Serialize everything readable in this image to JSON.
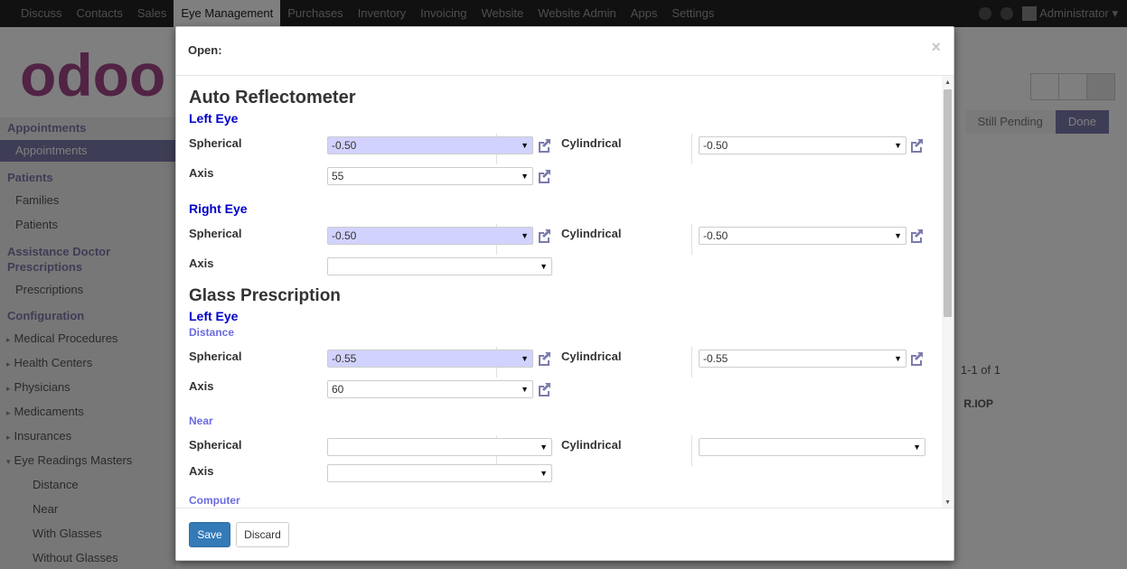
{
  "topbar": {
    "menu": [
      "Discuss",
      "Contacts",
      "Sales",
      "Eye Management",
      "Purchases",
      "Inventory",
      "Invoicing",
      "Website",
      "Website Admin",
      "Apps",
      "Settings"
    ],
    "active_index": 3,
    "user": "Administrator"
  },
  "logo_text": "odoo",
  "sidebar": {
    "appointments_head": "Appointments",
    "appointments_item": "Appointments",
    "patients_head": "Patients",
    "families": "Families",
    "patients": "Patients",
    "assist_head": "Assistance Doctor Prescriptions",
    "prescriptions": "Prescriptions",
    "config_head": "Configuration",
    "medical_procedures": "Medical Procedures",
    "health_centers": "Health Centers",
    "physicians": "Physicians",
    "medicaments": "Medicaments",
    "insurances": "Insurances",
    "eye_readings": "Eye Readings Masters",
    "distance": "Distance",
    "near": "Near",
    "with_glasses": "With Glasses",
    "without_glasses": "Without Glasses"
  },
  "background": {
    "status_pending": "Still Pending",
    "status_done": "Done",
    "pager": "1-1 of 1",
    "col_riop": "R.IOP"
  },
  "modal": {
    "title": "Open:",
    "close": "×",
    "auto_reflectometer": "Auto Reflectometer",
    "glass_prescription": "Glass Prescription",
    "left_eye": "Left Eye",
    "right_eye": "Right Eye",
    "distance": "Distance",
    "near": "Near",
    "computer": "Computer",
    "spherical": "Spherical",
    "cylindrical": "Cylindrical",
    "axis": "Axis",
    "ar_left": {
      "spherical": "-0.50",
      "cylindrical": "-0.50",
      "axis": "55"
    },
    "ar_right": {
      "spherical": "-0.50",
      "cylindrical": "-0.50",
      "axis": ""
    },
    "gp_left_distance": {
      "spherical": "-0.55",
      "cylindrical": "-0.55",
      "axis": "60"
    },
    "gp_left_near": {
      "spherical": "",
      "cylindrical": "",
      "axis": ""
    },
    "save": "Save",
    "discard": "Discard"
  },
  "colors": {
    "primary": "#337ab7",
    "odoo_purple": "#7c7bad",
    "required_field": "#d2d2ff",
    "section_blue": "#0000c8"
  }
}
